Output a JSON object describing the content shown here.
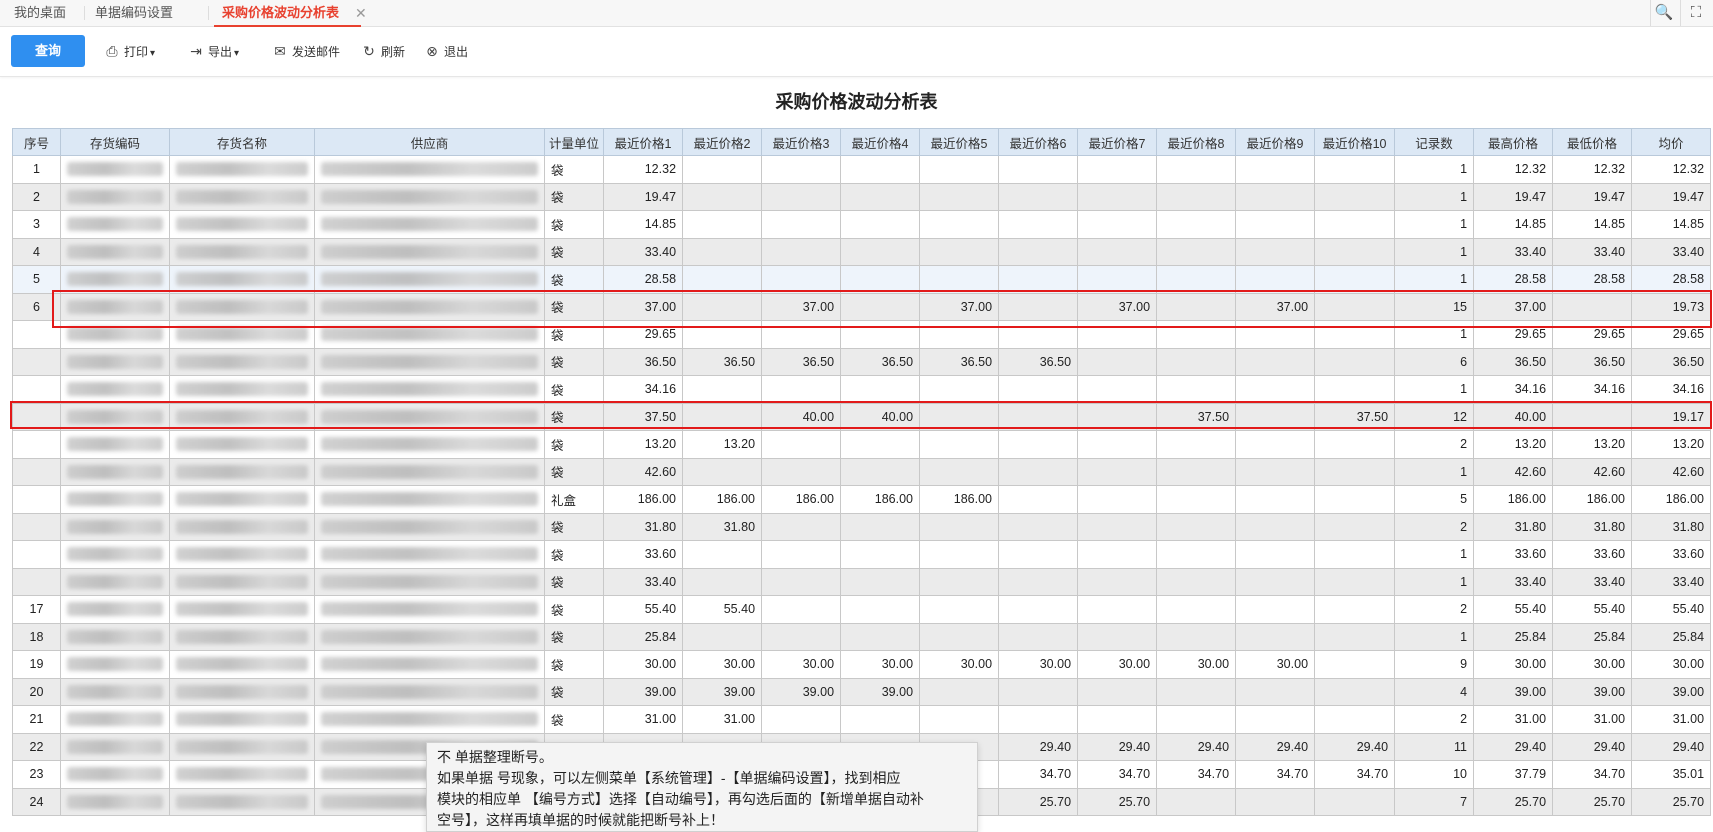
{
  "tabs": {
    "items": [
      {
        "label": "我的桌面"
      },
      {
        "label": "单据编码设置"
      },
      {
        "label": "采购价格波动分析表"
      }
    ],
    "close_glyph": "✕",
    "search_glyph": "🔍",
    "fullscreen_glyph": "⛶"
  },
  "toolbar": {
    "query_label": "查询",
    "print_label": "打印",
    "export_label": "导出",
    "send_mail_label": "发送邮件",
    "refresh_label": "刷新",
    "exit_label": "退出"
  },
  "report": {
    "title": "采购价格波动分析表"
  },
  "table": {
    "columns": [
      "序号",
      "存货编码",
      "存货名称",
      "供应商",
      "计量单位",
      "最近价格1",
      "最近价格2",
      "最近价格3",
      "最近价格4",
      "最近价格5",
      "最近价格6",
      "最近价格7",
      "最近价格8",
      "最近价格9",
      "最近价格10",
      "记录数",
      "最高价格",
      "最低价格",
      "均价"
    ],
    "rows": [
      {
        "no": "1",
        "unit": "袋",
        "p": [
          "12.32",
          "",
          "",
          "",
          "",
          "",
          "",
          "",
          "",
          ""
        ],
        "count": "1",
        "max": "12.32",
        "min": "12.32",
        "avg": "12.32"
      },
      {
        "no": "2",
        "unit": "袋",
        "p": [
          "19.47",
          "",
          "",
          "",
          "",
          "",
          "",
          "",
          "",
          ""
        ],
        "count": "1",
        "max": "19.47",
        "min": "19.47",
        "avg": "19.47"
      },
      {
        "no": "3",
        "unit": "袋",
        "p": [
          "14.85",
          "",
          "",
          "",
          "",
          "",
          "",
          "",
          "",
          ""
        ],
        "count": "1",
        "max": "14.85",
        "min": "14.85",
        "avg": "14.85"
      },
      {
        "no": "4",
        "unit": "袋",
        "p": [
          "33.40",
          "",
          "",
          "",
          "",
          "",
          "",
          "",
          "",
          ""
        ],
        "count": "1",
        "max": "33.40",
        "min": "33.40",
        "avg": "33.40"
      },
      {
        "no": "5",
        "unit": "袋",
        "p": [
          "28.58",
          "",
          "",
          "",
          "",
          "",
          "",
          "",
          "",
          ""
        ],
        "count": "1",
        "max": "28.58",
        "min": "28.58",
        "avg": "28.58"
      },
      {
        "no": "6",
        "unit": "袋",
        "p": [
          "37.00",
          "",
          "37.00",
          "",
          "37.00",
          "",
          "37.00",
          "",
          "37.00",
          ""
        ],
        "count": "15",
        "max": "37.00",
        "min": "",
        "avg": "19.73"
      },
      {
        "no": "",
        "unit": "袋",
        "p": [
          "29.65",
          "",
          "",
          "",
          "",
          "",
          "",
          "",
          "",
          ""
        ],
        "count": "1",
        "max": "29.65",
        "min": "29.65",
        "avg": "29.65"
      },
      {
        "no": "",
        "unit": "袋",
        "p": [
          "36.50",
          "36.50",
          "36.50",
          "36.50",
          "36.50",
          "36.50",
          "",
          "",
          "",
          ""
        ],
        "count": "6",
        "max": "36.50",
        "min": "36.50",
        "avg": "36.50"
      },
      {
        "no": "",
        "unit": "袋",
        "p": [
          "34.16",
          "",
          "",
          "",
          "",
          "",
          "",
          "",
          "",
          ""
        ],
        "count": "1",
        "max": "34.16",
        "min": "34.16",
        "avg": "34.16"
      },
      {
        "no": "",
        "unit": "袋",
        "p": [
          "37.50",
          "",
          "40.00",
          "40.00",
          "",
          "",
          "",
          "37.50",
          "",
          "37.50"
        ],
        "count": "12",
        "max": "40.00",
        "min": "",
        "avg": "19.17"
      },
      {
        "no": "",
        "unit": "袋",
        "p": [
          "13.20",
          "13.20",
          "",
          "",
          "",
          "",
          "",
          "",
          "",
          ""
        ],
        "count": "2",
        "max": "13.20",
        "min": "13.20",
        "avg": "13.20"
      },
      {
        "no": "",
        "unit": "袋",
        "p": [
          "42.60",
          "",
          "",
          "",
          "",
          "",
          "",
          "",
          "",
          ""
        ],
        "count": "1",
        "max": "42.60",
        "min": "42.60",
        "avg": "42.60"
      },
      {
        "no": "",
        "unit": "礼盒",
        "p": [
          "186.00",
          "186.00",
          "186.00",
          "186.00",
          "186.00",
          "",
          "",
          "",
          "",
          ""
        ],
        "count": "5",
        "max": "186.00",
        "min": "186.00",
        "avg": "186.00"
      },
      {
        "no": "",
        "unit": "袋",
        "p": [
          "31.80",
          "31.80",
          "",
          "",
          "",
          "",
          "",
          "",
          "",
          ""
        ],
        "count": "2",
        "max": "31.80",
        "min": "31.80",
        "avg": "31.80"
      },
      {
        "no": "",
        "unit": "袋",
        "p": [
          "33.60",
          "",
          "",
          "",
          "",
          "",
          "",
          "",
          "",
          ""
        ],
        "count": "1",
        "max": "33.60",
        "min": "33.60",
        "avg": "33.60"
      },
      {
        "no": "",
        "unit": "袋",
        "p": [
          "33.40",
          "",
          "",
          "",
          "",
          "",
          "",
          "",
          "",
          ""
        ],
        "count": "1",
        "max": "33.40",
        "min": "33.40",
        "avg": "33.40"
      },
      {
        "no": "17",
        "unit": "袋",
        "p": [
          "55.40",
          "55.40",
          "",
          "",
          "",
          "",
          "",
          "",
          "",
          ""
        ],
        "count": "2",
        "max": "55.40",
        "min": "55.40",
        "avg": "55.40"
      },
      {
        "no": "18",
        "unit": "袋",
        "p": [
          "25.84",
          "",
          "",
          "",
          "",
          "",
          "",
          "",
          "",
          ""
        ],
        "count": "1",
        "max": "25.84",
        "min": "25.84",
        "avg": "25.84"
      },
      {
        "no": "19",
        "unit": "袋",
        "p": [
          "30.00",
          "30.00",
          "30.00",
          "30.00",
          "30.00",
          "30.00",
          "30.00",
          "30.00",
          "30.00",
          ""
        ],
        "count": "9",
        "max": "30.00",
        "min": "30.00",
        "avg": "30.00"
      },
      {
        "no": "20",
        "unit": "袋",
        "p": [
          "39.00",
          "39.00",
          "39.00",
          "39.00",
          "",
          "",
          "",
          "",
          "",
          ""
        ],
        "count": "4",
        "max": "39.00",
        "min": "39.00",
        "avg": "39.00"
      },
      {
        "no": "21",
        "unit": "袋",
        "p": [
          "31.00",
          "31.00",
          "",
          "",
          "",
          "",
          "",
          "",
          "",
          ""
        ],
        "count": "2",
        "max": "31.00",
        "min": "31.00",
        "avg": "31.00"
      },
      {
        "no": "22",
        "unit": "",
        "p": [
          "",
          "",
          "",
          "",
          "",
          "29.40",
          "29.40",
          "29.40",
          "29.40",
          "29.40"
        ],
        "count": "11",
        "max": "29.40",
        "min": "29.40",
        "avg": "29.40"
      },
      {
        "no": "23",
        "unit": "",
        "p": [
          "",
          "",
          "",
          "",
          "",
          "34.70",
          "34.70",
          "34.70",
          "34.70",
          "34.70"
        ],
        "count": "10",
        "max": "37.79",
        "min": "34.70",
        "avg": "35.01"
      },
      {
        "no": "24",
        "unit": "",
        "p": [
          "",
          "",
          "",
          "",
          "",
          "25.70",
          "25.70",
          "",
          "",
          ""
        ],
        "count": "7",
        "max": "25.70",
        "min": "25.70",
        "avg": "25.70"
      }
    ]
  },
  "tooltip": {
    "line1": "不   单据整理断号。",
    "line2": "如果单据      号现象，可以左侧菜单【系统管理】-【单据编码设置】，找到相应",
    "line3": "模块的相应单   【编号方式】选择【自动编号】，再勾选后面的【新增单据自动补",
    "line4": "空号】，这样再填单据的时候就能把断号补上！"
  }
}
